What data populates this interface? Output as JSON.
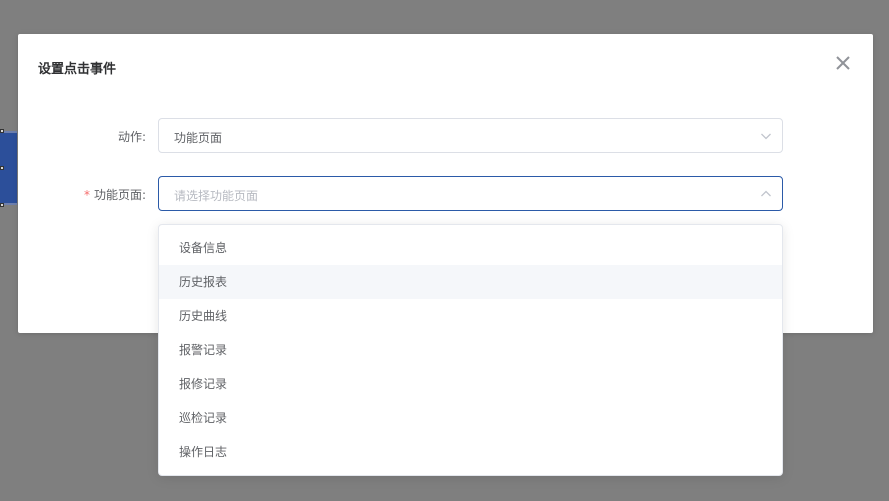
{
  "dialog": {
    "title": "设置点击事件",
    "close_icon": "close-icon"
  },
  "form": {
    "action": {
      "label": "动作:",
      "value": "功能页面",
      "arrow_icon": "chevron-down-icon"
    },
    "function_page": {
      "required_mark": "*",
      "label": "功能页面:",
      "placeholder": "请选择功能页面",
      "arrow_icon": "chevron-up-icon"
    }
  },
  "dropdown": {
    "options": [
      {
        "label": "设备信息"
      },
      {
        "label": "历史报表"
      },
      {
        "label": "历史曲线"
      },
      {
        "label": "报警记录"
      },
      {
        "label": "报修记录"
      },
      {
        "label": "巡检记录"
      },
      {
        "label": "操作日志"
      }
    ],
    "hovered_index": 1
  },
  "colors": {
    "overlay": "#7f7f7f",
    "focus_border": "#2b5aa8",
    "required": "#f56c6c",
    "hover_bg": "#f5f7fa"
  }
}
